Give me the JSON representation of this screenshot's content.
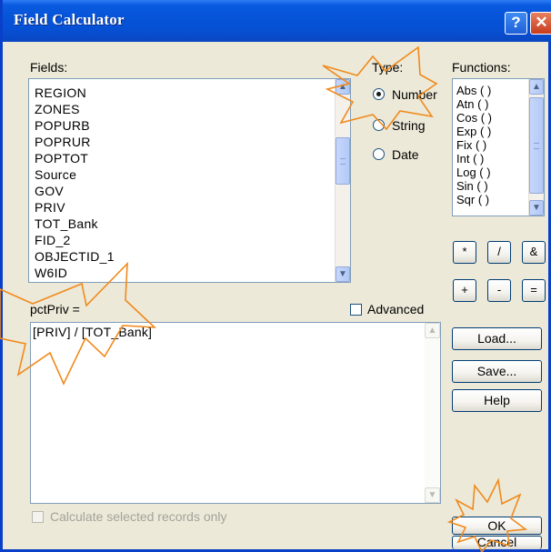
{
  "window": {
    "title": "Field Calculator",
    "help_glyph": "?",
    "close_glyph": "✕"
  },
  "fields": {
    "label": "Fields:",
    "items": [
      "REGION",
      "ZONES",
      "POPURB",
      "POPRUR",
      "POPTOT",
      "Source",
      "GOV",
      "PRIV",
      "TOT_Bank",
      "FID_2",
      "OBJECTID_1",
      "W6ID"
    ]
  },
  "type": {
    "label": "Type:",
    "options": [
      "Number",
      "String",
      "Date"
    ],
    "selected": "Number"
  },
  "functions": {
    "label": "Functions:",
    "items": [
      "Abs ( )",
      "Atn ( )",
      "Cos ( )",
      "Exp ( )",
      "Fix ( )",
      "Int ( )",
      "Log ( )",
      "Sin ( )",
      "Sqr ( )"
    ]
  },
  "operators": [
    "*",
    "/",
    "&",
    "+",
    "-",
    "="
  ],
  "expression": {
    "target_label": "pctPriv =",
    "advanced_label": "Advanced",
    "text": "[PRIV] / [TOT_Bank]"
  },
  "buttons": {
    "load": "Load...",
    "save": "Save...",
    "help": "Help",
    "ok": "OK",
    "cancel": "Cancel"
  },
  "calc_selected_label": "Calculate selected records only",
  "colors": {
    "titlebar": "#0654d8",
    "dialog_face": "#ece9d8",
    "annotation_stroke": "#f08a1c"
  },
  "icons": {
    "scroll_up": "up-arrow-icon",
    "scroll_down": "down-arrow-icon"
  }
}
